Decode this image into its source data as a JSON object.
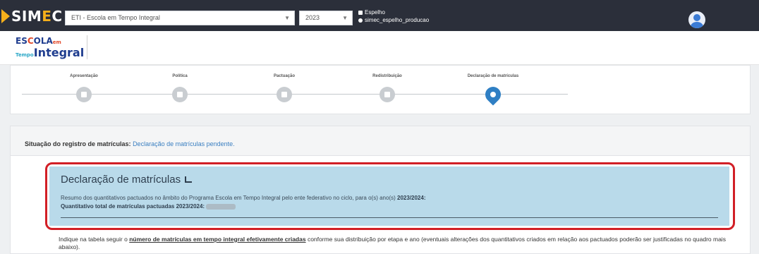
{
  "topbar": {
    "brand_prefix": "SIM",
    "brand_letter": "E",
    "brand_suffix": "C",
    "program_select": "ETI - Escola em Tempo Integral",
    "year_select": "2023",
    "env_name": "Espelho",
    "env_db": "simec_espelho_producao"
  },
  "brand_logo": {
    "line1_a": "ES",
    "line1_o": "C",
    "line1_b": "OLA",
    "line1_em": "em",
    "line2_tempo": "Tempo",
    "line2_integral": "Integral"
  },
  "stepper": {
    "steps": [
      {
        "label": "Apresentação",
        "icon": "flag-icon"
      },
      {
        "label": "Política",
        "icon": "document-icon"
      },
      {
        "label": "Pactuação",
        "icon": "handshake-icon"
      },
      {
        "label": "Redistribuição",
        "icon": "handshake-icon"
      },
      {
        "label": "Declaração de matrículas",
        "icon": "user-icon",
        "active": true
      }
    ]
  },
  "status": {
    "label": "Situação do registro de matrículas:",
    "value": "Declaração de matrículas pendente."
  },
  "declaration": {
    "title": "Declaração de matrículas",
    "summary": "Resumo dos quantitativos pactuados no âmbito do Programa Escola em Tempo Integral pelo ente federativo no ciclo, para o(s) ano(s)",
    "summary_years": "2023/2024:",
    "total_label": "Quantitativo total de matrículas pactuadas 2023/2024:"
  },
  "instructions": {
    "prefix": "Indique na tabela seguir o",
    "emphasis": "número de matrículas em tempo integral efetivamente criadas",
    "suffix": "conforme sua distribuição por etapa e ano (eventuais alterações dos quantitativos criados em relação aos pactuados poderão ser justificadas no quadro mais abaixo)."
  },
  "colors": {
    "topbar": "#2b2f3a",
    "accent": "#f6b01b",
    "active_step": "#2f7fc4",
    "declaration_bg": "#b9daea",
    "highlight_outline": "#d21f26"
  }
}
